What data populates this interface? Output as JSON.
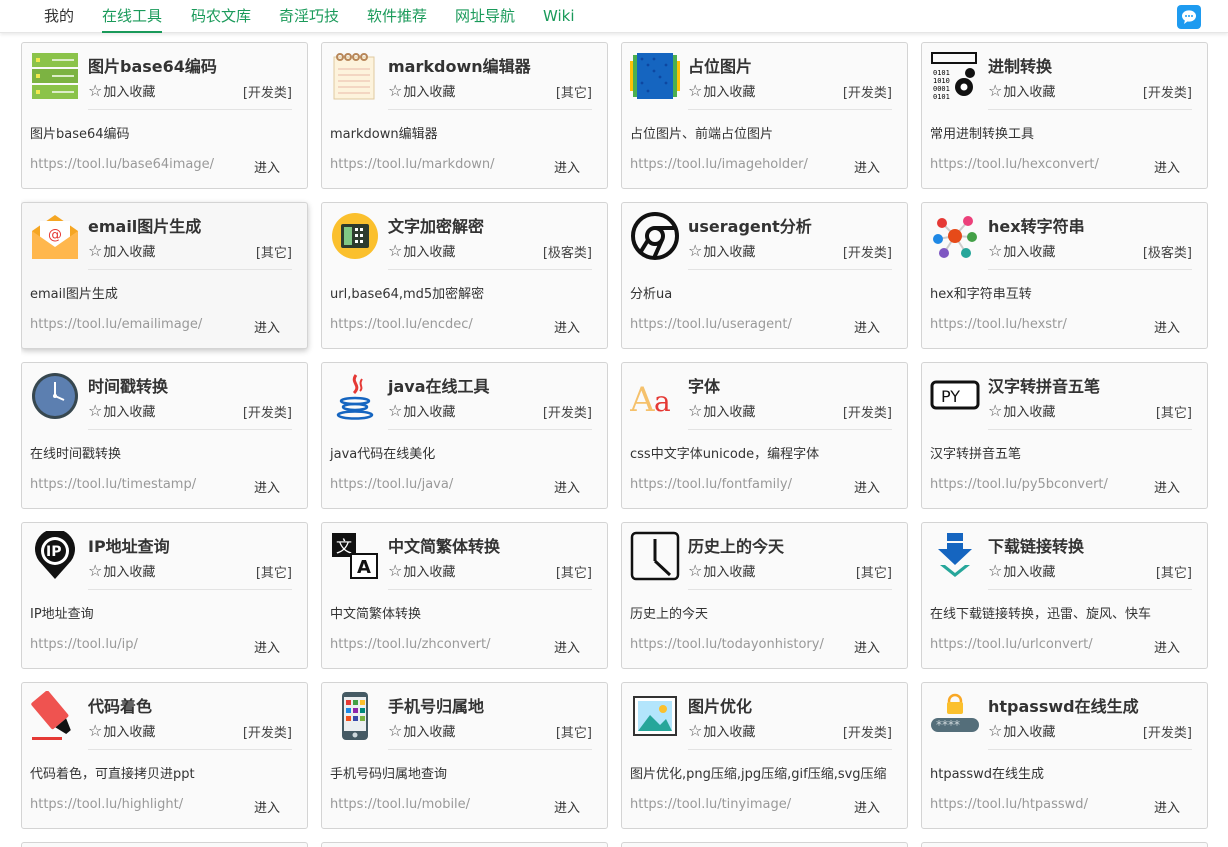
{
  "nav": {
    "items": [
      "我的",
      "在线工具",
      "码农文库",
      "奇淫巧技",
      "软件推荐",
      "网址导航",
      "Wiki"
    ],
    "active_index": 1
  },
  "colors": {
    "accent": "#1a9a5a",
    "chat_button": "#1e9bf0",
    "url_text": "#999999"
  },
  "fav_label": "加入收藏",
  "enter_label": "进入",
  "cards": [
    {
      "title": "图片base64编码",
      "category": "[开发类]",
      "desc": "图片base64编码",
      "url": "https://tool.lu/base64image/",
      "icon": "server-icon"
    },
    {
      "title": "markdown编辑器",
      "category": "[其它]",
      "desc": "markdown编辑器",
      "url": "https://tool.lu/markdown/",
      "icon": "notepad-icon"
    },
    {
      "title": "占位图片",
      "category": "[开发类]",
      "desc": "占位图片、前端占位图片",
      "url": "https://tool.lu/imageholder/",
      "icon": "placeholder-image-icon"
    },
    {
      "title": "进制转换",
      "category": "[开发类]",
      "desc": "常用进制转换工具",
      "url": "https://tool.lu/hexconvert/",
      "icon": "binary-gear-icon"
    },
    {
      "title": "email图片生成",
      "category": "[其它]",
      "desc": "email图片生成",
      "url": "https://tool.lu/emailimage/",
      "icon": "email-icon"
    },
    {
      "title": "文字加密解密",
      "category": "[极客类]",
      "desc": "url,base64,md5加密解密",
      "url": "https://tool.lu/encdec/",
      "icon": "lock-icon"
    },
    {
      "title": "useragent分析",
      "category": "[开发类]",
      "desc": "分析ua",
      "url": "https://tool.lu/useragent/",
      "icon": "chrome-icon"
    },
    {
      "title": "hex转字符串",
      "category": "[极客类]",
      "desc": "hex和字符串互转",
      "url": "https://tool.lu/hexstr/",
      "icon": "molecule-icon"
    },
    {
      "title": "时间戳转换",
      "category": "[开发类]",
      "desc": "在线时间戳转换",
      "url": "https://tool.lu/timestamp/",
      "icon": "clock-icon"
    },
    {
      "title": "java在线工具",
      "category": "[开发类]",
      "desc": "java代码在线美化",
      "url": "https://tool.lu/java/",
      "icon": "java-icon"
    },
    {
      "title": "字体",
      "category": "[开发类]",
      "desc": "css中文字体unicode，编程字体",
      "url": "https://tool.lu/fontfamily/",
      "icon": "font-icon"
    },
    {
      "title": "汉字转拼音五笔",
      "category": "[其它]",
      "desc": "汉字转拼音五笔",
      "url": "https://tool.lu/py5bconvert/",
      "icon": "py-icon"
    },
    {
      "title": "IP地址查询",
      "category": "[其它]",
      "desc": "IP地址查询",
      "url": "https://tool.lu/ip/",
      "icon": "ip-pin-icon"
    },
    {
      "title": "中文简繁体转换",
      "category": "[其它]",
      "desc": "中文简繁体转换",
      "url": "https://tool.lu/zhconvert/",
      "icon": "translate-icon"
    },
    {
      "title": "历史上的今天",
      "category": "[其它]",
      "desc": "历史上的今天",
      "url": "https://tool.lu/todayonhistory/",
      "icon": "history-clock-icon"
    },
    {
      "title": "下载链接转换",
      "category": "[其它]",
      "desc": "在线下载链接转换，迅雷、旋风、快车",
      "url": "https://tool.lu/urlconvert/",
      "icon": "download-icon"
    },
    {
      "title": "代码着色",
      "category": "[开发类]",
      "desc": "代码着色，可直接拷贝进ppt",
      "url": "https://tool.lu/highlight/",
      "icon": "highlighter-icon"
    },
    {
      "title": "手机号归属地",
      "category": "[其它]",
      "desc": "手机号码归属地查询",
      "url": "https://tool.lu/mobile/",
      "icon": "phone-icon"
    },
    {
      "title": "图片优化",
      "category": "[开发类]",
      "desc": "图片优化,png压缩,jpg压缩,gif压缩,svg压缩",
      "url": "https://tool.lu/tinyimage/",
      "icon": "picture-icon"
    },
    {
      "title": "htpasswd在线生成",
      "category": "[开发类]",
      "desc": "htpasswd在线生成",
      "url": "https://tool.lu/htpasswd/",
      "icon": "password-icon"
    }
  ]
}
